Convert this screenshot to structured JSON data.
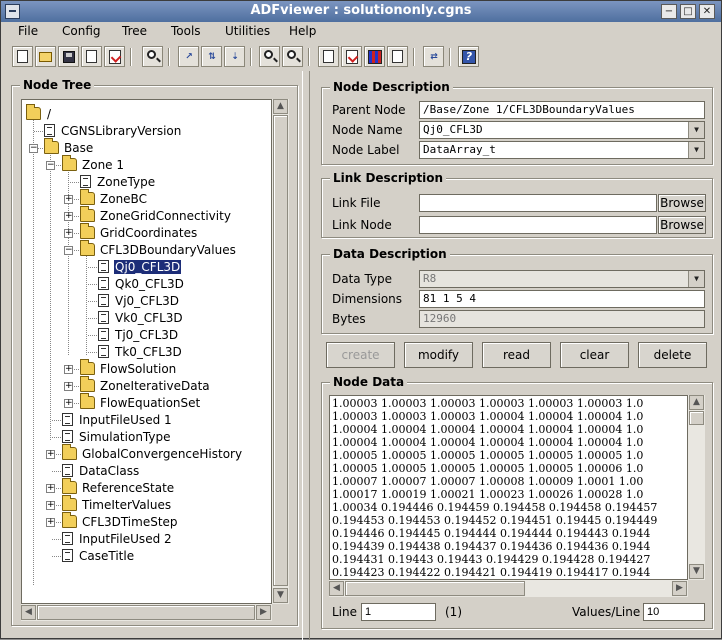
{
  "window": {
    "title": "ADFviewer : solutiononly.cgns",
    "controls": [
      "−",
      "□",
      "✕"
    ]
  },
  "menu": [
    "File",
    "Config",
    "Tree",
    "Tools",
    "Utilities",
    "Help"
  ],
  "tree": {
    "title": "Node Tree",
    "root": "/",
    "nodes": [
      {
        "label": "CGNSLibraryVersion"
      },
      {
        "label": "Base"
      },
      {
        "label": "Zone   1"
      },
      {
        "label": "ZoneType"
      },
      {
        "label": "ZoneBC"
      },
      {
        "label": "ZoneGridConnectivity"
      },
      {
        "label": "GridCoordinates"
      },
      {
        "label": "CFL3DBoundaryValues"
      },
      {
        "label": "Qj0_CFL3D"
      },
      {
        "label": "Qk0_CFL3D"
      },
      {
        "label": "Vj0_CFL3D"
      },
      {
        "label": "Vk0_CFL3D"
      },
      {
        "label": "Tj0_CFL3D"
      },
      {
        "label": "Tk0_CFL3D"
      },
      {
        "label": "FlowSolution"
      },
      {
        "label": "ZoneIterativeData"
      },
      {
        "label": "FlowEquationSet"
      },
      {
        "label": "InputFileUsed 1"
      },
      {
        "label": "SimulationType"
      },
      {
        "label": "GlobalConvergenceHistory"
      },
      {
        "label": "DataClass"
      },
      {
        "label": "ReferenceState"
      },
      {
        "label": "TimeIterValues"
      },
      {
        "label": "CFL3DTimeStep"
      },
      {
        "label": "InputFileUsed 2"
      },
      {
        "label": "CaseTitle"
      }
    ]
  },
  "node_description": {
    "title": "Node Description",
    "parent_node_label": "Parent Node",
    "parent_node_value": "/Base/Zone   1/CFL3DBoundaryValues",
    "node_name_label": "Node Name",
    "node_name_value": "Qj0_CFL3D",
    "node_label_label": "Node Label",
    "node_label_value": "DataArray_t"
  },
  "link_description": {
    "title": "Link Description",
    "link_file_label": "Link File",
    "link_file_value": "",
    "link_node_label": "Link Node",
    "link_node_value": "",
    "browse_label": "Browse"
  },
  "data_description": {
    "title": "Data Description",
    "data_type_label": "Data Type",
    "data_type_value": "R8",
    "dimensions_label": "Dimensions",
    "dimensions_value": "81 1 5 4",
    "bytes_label": "Bytes",
    "bytes_value": "12960"
  },
  "actions": {
    "create": "create",
    "modify": "modify",
    "read": "read",
    "clear": "clear",
    "delete": "delete"
  },
  "node_data": {
    "title": "Node Data",
    "lines": [
      "1.00003 1.00003 1.00003 1.00003 1.00003 1.00003 1.0",
      "1.00003 1.00003 1.00003 1.00004 1.00004 1.00004 1.0",
      "1.00004 1.00004 1.00004 1.00004 1.00004 1.00004 1.0",
      "1.00004 1.00004 1.00004 1.00004 1.00004 1.00004 1.0",
      "1.00005 1.00005 1.00005 1.00005 1.00005 1.00005 1.0",
      "1.00005 1.00005 1.00005 1.00005 1.00005 1.00006 1.0",
      "1.00007 1.00007 1.00007 1.00008 1.00009 1.0001 1.00",
      "1.00017 1.00019 1.00021 1.00023 1.00026 1.00028 1.0",
      "1.00034 0.194446 0.194459 0.194458 0.194458 0.194457",
      "0.194453 0.194453 0.194452 0.194451 0.19445 0.194449",
      "0.194446 0.194445 0.194444 0.194444 0.194443 0.1944",
      "0.194439 0.194438 0.194437 0.194436 0.194436 0.1944",
      "0.194431 0.19443 0.19443 0.194429 0.194428 0.194427",
      "0.194423 0.194422 0.194421 0.194419 0.194417 0.1944"
    ],
    "line_label": "Line",
    "line_value": "1",
    "line_count": "(1)",
    "values_per_line_label": "Values/Line",
    "values_per_line_value": "10"
  }
}
